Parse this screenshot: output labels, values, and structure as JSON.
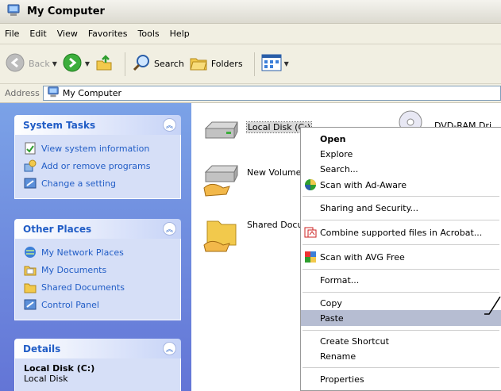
{
  "window": {
    "title": "My Computer"
  },
  "menubar": [
    "File",
    "Edit",
    "View",
    "Favorites",
    "Tools",
    "Help"
  ],
  "toolbar": {
    "back_label": "Back",
    "search_label": "Search",
    "folders_label": "Folders"
  },
  "address": {
    "label": "Address",
    "value": "My Computer"
  },
  "sidebar": {
    "system_tasks": {
      "title": "System Tasks",
      "items": [
        "View system information",
        "Add or remove programs",
        "Change a setting"
      ]
    },
    "other_places": {
      "title": "Other Places",
      "items": [
        "My Network Places",
        "My Documents",
        "Shared Documents",
        "Control Panel"
      ]
    },
    "details": {
      "title": "Details",
      "name": "Local Disk (C:)",
      "type": "Local Disk"
    }
  },
  "content": {
    "items": [
      {
        "label": "Local Disk (C:)",
        "icon": "hard-disk-icon"
      },
      {
        "label": "New Volume (",
        "icon": "shared-disk-icon"
      },
      {
        "label": "Shared Docur",
        "icon": "shared-folder-icon"
      },
      {
        "label": "DVD-RAM Dri",
        "icon": "dvd-drive-icon"
      }
    ]
  },
  "context_menu": {
    "items": [
      "Open",
      "Explore",
      "Search...",
      "Scan with Ad-Aware",
      "Sharing and Security...",
      "Combine supported files in Acrobat...",
      "Scan with AVG Free",
      "Format...",
      "Copy",
      "Paste",
      "Create Shortcut",
      "Rename",
      "Properties"
    ],
    "highlighted": "Paste"
  },
  "colors": {
    "sidebar_top": "#7ba2e7",
    "sidebar_bottom": "#6375d6",
    "link_blue": "#215dc6",
    "highlight": "#b6bdd2"
  }
}
